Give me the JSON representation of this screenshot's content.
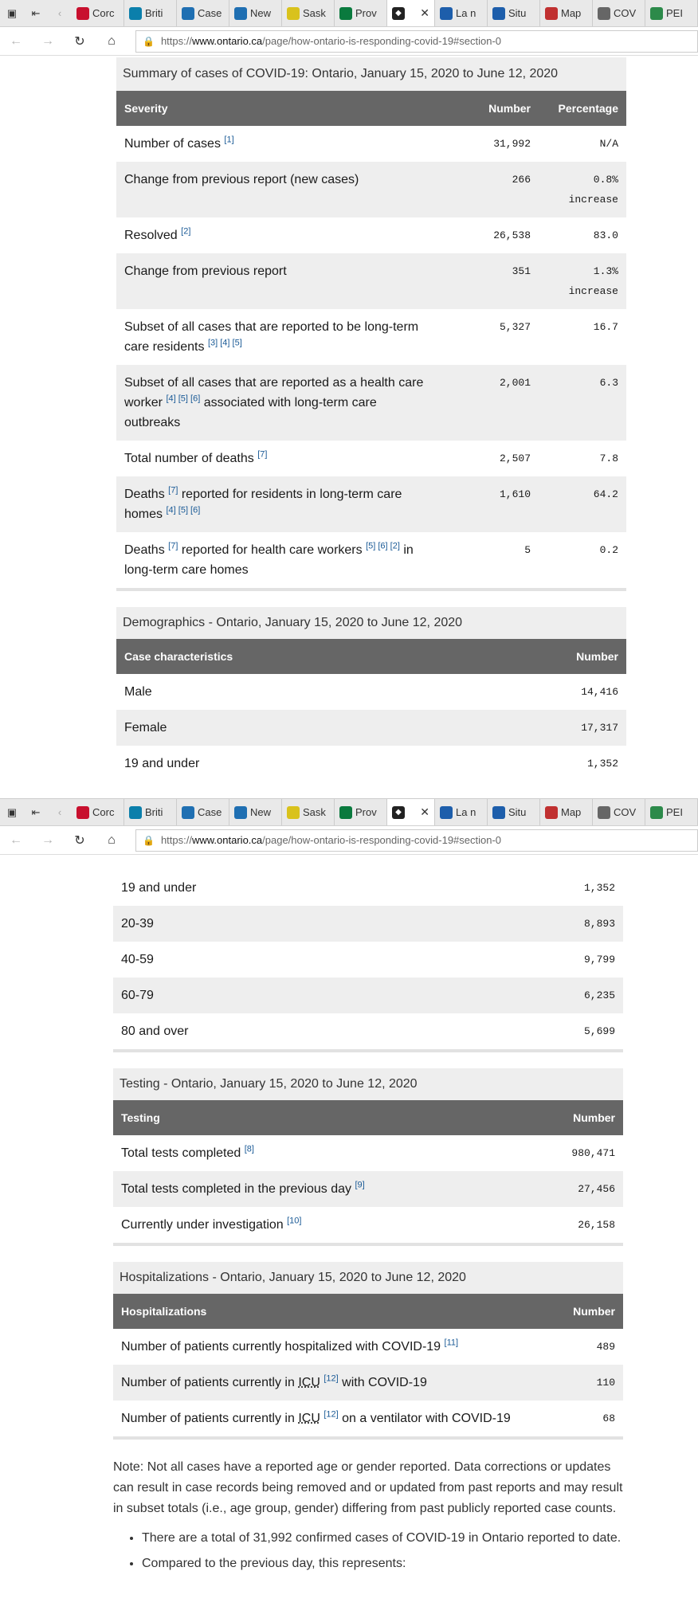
{
  "browser": {
    "tabs": [
      {
        "label": "Corc",
        "icon": "maple-leaf-icon",
        "color": "#c8102e"
      },
      {
        "label": "Briti",
        "icon": "bc-icon",
        "color": "#0b7fab"
      },
      {
        "label": "Case",
        "icon": "chart-icon",
        "color": "#1f6fb2"
      },
      {
        "label": "New",
        "icon": "chart-icon",
        "color": "#1f6fb2"
      },
      {
        "label": "Sask",
        "icon": "sask-icon",
        "color": "#d9c21c"
      },
      {
        "label": "Prov",
        "icon": "green-icon",
        "color": "#0a7a3e"
      }
    ],
    "tabs_after": [
      {
        "label": "La n",
        "icon": "fleur-icon",
        "color": "#1d5eab"
      },
      {
        "label": "Situ",
        "icon": "fleur-icon",
        "color": "#1d5eab"
      },
      {
        "label": "Map",
        "icon": "map-icon",
        "color": "#c03030"
      },
      {
        "label": "COV",
        "icon": "image-icon",
        "color": "#666666"
      },
      {
        "label": "PEI",
        "icon": "pei-icon",
        "color": "#2c8a4a"
      }
    ],
    "url_prefix": "https://",
    "url_domain": "www.ontario.ca",
    "url_path": "/page/how-ontario-is-responding-covid-19#section-0"
  },
  "summary": {
    "title": "Summary of cases of COVID-19: Ontario, January 15, 2020 to June 12, 2020",
    "headers": [
      "Severity",
      "Number",
      "Percentage"
    ],
    "rows": [
      {
        "label": "Number of cases",
        "refs": "[1]",
        "number": "31,992",
        "pct": "N/A"
      },
      {
        "label": "Change from previous report (new cases)",
        "number": "266",
        "pct": "0.8%",
        "pct2": "increase"
      },
      {
        "label": "Resolved",
        "refs": "[2]",
        "number": "26,538",
        "pct": "83.0"
      },
      {
        "label": "Change from previous report",
        "number": "351",
        "pct": "1.3%",
        "pct2": "increase"
      },
      {
        "label": "Subset of all cases that are reported to be long-term care residents",
        "refs": "[3] [4] [5]",
        "number": "5,327",
        "pct": "16.7"
      },
      {
        "label_a": "Subset of all cases that are reported as a health care worker",
        "refs": "[4] [5] [6]",
        "label_b": "associated with long-term care outbreaks",
        "number": "2,001",
        "pct": "6.3"
      },
      {
        "label": "Total number of deaths",
        "refs": "[7]",
        "number": "2,507",
        "pct": "7.8"
      },
      {
        "label_a": "Deaths",
        "refs_a": "[7]",
        "label_b": "reported for residents in long-term care homes",
        "refs": "[4] [5] [6]",
        "number": "1,610",
        "pct": "64.2"
      },
      {
        "label_a": "Deaths",
        "refs_a": "[7]",
        "label_b": "reported for health care workers",
        "refs": "[5] [6] [2]",
        "label_c": "in long-term care homes",
        "number": "5",
        "pct": "0.2"
      }
    ]
  },
  "demographics": {
    "title": "Demographics - Ontario, January 15, 2020 to June 12, 2020",
    "headers": [
      "Case characteristics",
      "Number"
    ],
    "rows": [
      {
        "label": "Male",
        "number": "14,416"
      },
      {
        "label": "Female",
        "number": "17,317"
      },
      {
        "label": "19 and under",
        "number": "1,352"
      },
      {
        "label": "20-39",
        "number": "8,893"
      },
      {
        "label": "40-59",
        "number": "9,799"
      },
      {
        "label": "60-79",
        "number": "6,235"
      },
      {
        "label": "80 and over",
        "number": "5,699"
      }
    ]
  },
  "testing": {
    "title": "Testing - Ontario, January 15, 2020 to June 12, 2020",
    "headers": [
      "Testing",
      "Number"
    ],
    "rows": [
      {
        "label": "Total tests completed",
        "refs": "[8]",
        "number": "980,471"
      },
      {
        "label": "Total tests completed in the previous day",
        "refs": "[9]",
        "number": "27,456"
      },
      {
        "label": "Currently under investigation",
        "refs": "[10]",
        "number": "26,158"
      }
    ]
  },
  "hospitalizations": {
    "title": "Hospitalizations - Ontario, January 15, 2020 to June 12, 2020",
    "headers": [
      "Hospitalizations",
      "Number"
    ],
    "rows": [
      {
        "label": "Number of patients currently hospitalized with COVID-19",
        "refs": "[11]",
        "number": "489"
      },
      {
        "label_a": "Number of patients currently in",
        "abbr": "ICU",
        "refs": "[12]",
        "label_b": "with COVID-19",
        "number": "110"
      },
      {
        "label_a": "Number of patients currently in",
        "abbr": "ICU",
        "refs": "[12]",
        "label_b": "on a ventilator with COVID-19",
        "number": "68"
      }
    ]
  },
  "note": "Note: Not all cases have a reported age or gender reported. Data corrections or updates can result in case records being removed and or updated from past reports and may result in subset totals (i.e., age group, gender) differing from past publicly reported case counts.",
  "bullets": [
    "There are a total of 31,992 confirmed cases of COVID-19 in Ontario reported to date.",
    "Compared to the previous day, this represents:"
  ]
}
